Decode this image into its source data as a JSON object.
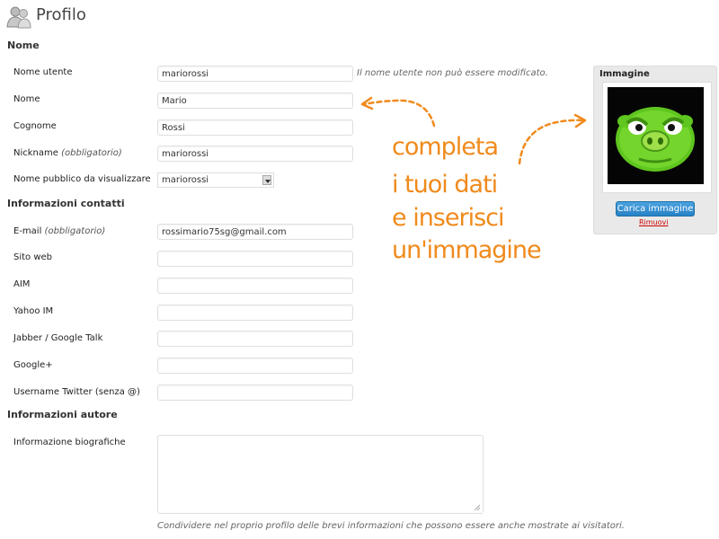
{
  "header": {
    "title": "Profilo"
  },
  "sections": {
    "name": "Nome",
    "contacts": "Informazioni contatti",
    "author": "Informazioni autore"
  },
  "fields": {
    "username": {
      "label": "Nome utente",
      "value": "mariorossi",
      "note": "Il nome utente non può essere modificato."
    },
    "first_name": {
      "label": "Nome",
      "value": "Mario"
    },
    "last_name": {
      "label": "Cognome",
      "value": "Rossi"
    },
    "nickname": {
      "label": "Nickname",
      "required": "(obbligatorio)",
      "value": "mariorossi"
    },
    "display_name": {
      "label": "Nome pubblico da visualizzare",
      "value": "mariorossi"
    },
    "email": {
      "label": "E-mail",
      "required": "(obbligatorio)",
      "value": "rossimario75sg@gmail.com"
    },
    "website": {
      "label": "Sito web",
      "value": ""
    },
    "aim": {
      "label": "AIM",
      "value": ""
    },
    "yahoo": {
      "label": "Yahoo IM",
      "value": ""
    },
    "jabber": {
      "label": "Jabber / Google Talk",
      "value": ""
    },
    "gplus": {
      "label": "Google+",
      "value": ""
    },
    "twitter": {
      "label": "Username Twitter (senza @)",
      "value": ""
    },
    "bio": {
      "label": "Informazione biografiche",
      "value": "",
      "note": "Condividere nel proprio profilo delle brevi informazioni che possono essere anche mostrate ai visitatori."
    }
  },
  "image_panel": {
    "title": "Immagine",
    "upload_label": "Carica immagine",
    "remove_label": "Rimuovi"
  },
  "annotation": {
    "lines": [
      "completa",
      "i tuoi dati",
      "e inserisci",
      "un'immagine"
    ],
    "color": "#f08a1c"
  },
  "colors": {
    "accent_button": "#2e8fd2",
    "remove_link": "#cc0000"
  }
}
